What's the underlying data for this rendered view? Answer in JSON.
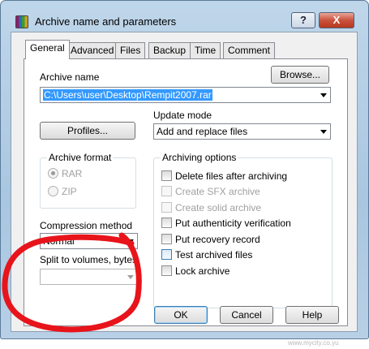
{
  "window": {
    "title": "Archive name and parameters",
    "help_label": "?",
    "close_label": "X"
  },
  "tabs": [
    {
      "label": "General"
    },
    {
      "label": "Advanced"
    },
    {
      "label": "Files"
    },
    {
      "label": "Backup"
    },
    {
      "label": "Time"
    },
    {
      "label": "Comment"
    }
  ],
  "general": {
    "archive_name_label": "Archive name",
    "browse_label": "Browse...",
    "archive_name_value": "C:\\Users\\user\\Desktop\\Rempit2007.rar",
    "profiles_label": "Profiles...",
    "update_mode_label": "Update mode",
    "update_mode_value": "Add and replace files",
    "archive_format": {
      "title": "Archive format",
      "options": [
        {
          "label": "RAR",
          "selected": true
        },
        {
          "label": "ZIP",
          "selected": false
        }
      ]
    },
    "compression_method_label": "Compression method",
    "compression_method_value": "Normal",
    "split_label": "Split to volumes, bytes",
    "split_value": "",
    "archiving_options": {
      "title": "Archiving options",
      "items": [
        {
          "label": "Delete files after archiving",
          "checked": false,
          "enabled": true
        },
        {
          "label": "Create SFX archive",
          "checked": false,
          "enabled": false
        },
        {
          "label": "Create solid archive",
          "checked": false,
          "enabled": false
        },
        {
          "label": "Put authenticity verification",
          "checked": false,
          "enabled": true
        },
        {
          "label": "Put recovery record",
          "checked": false,
          "enabled": true
        },
        {
          "label": "Test archived files",
          "checked": false,
          "enabled": true
        },
        {
          "label": "Lock archive",
          "checked": false,
          "enabled": true
        }
      ]
    }
  },
  "footer": {
    "ok_label": "OK",
    "cancel_label": "Cancel",
    "help_label": "Help"
  },
  "annotation": {
    "color": "#e8141b"
  },
  "watermark": {
    "text": "www.mycity.co.yu"
  }
}
